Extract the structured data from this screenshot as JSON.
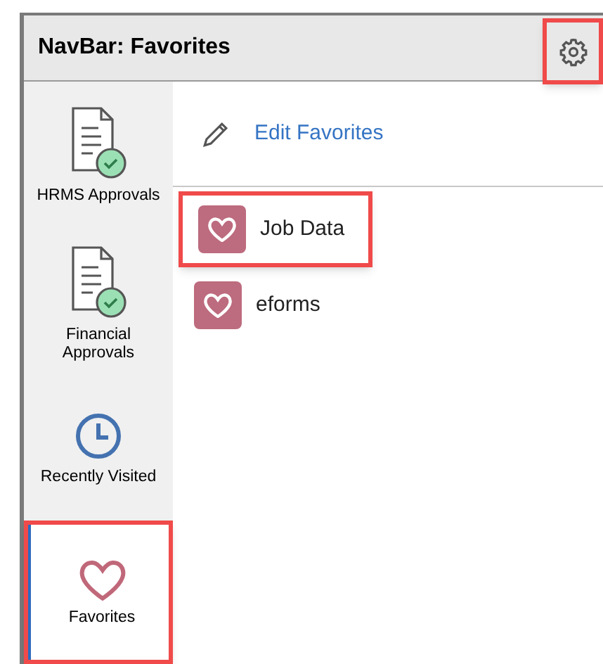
{
  "header": {
    "title": "NavBar: Favorites",
    "settings_highlighted": true
  },
  "sidebar": {
    "items": [
      {
        "kind": "approval",
        "label": "HRMS Approvals",
        "selected": false,
        "highlighted": false
      },
      {
        "kind": "approval",
        "label": "Financial Approvals",
        "selected": false,
        "highlighted": false
      },
      {
        "kind": "recent",
        "label": "Recently Visited",
        "selected": false,
        "highlighted": false
      },
      {
        "kind": "favorite",
        "label": "Favorites",
        "selected": true,
        "highlighted": true
      }
    ]
  },
  "edit_link": "Edit Favorites",
  "favorites": [
    {
      "label": "Job Data",
      "highlighted": true
    },
    {
      "label": "eforms",
      "highlighted": false
    }
  ]
}
